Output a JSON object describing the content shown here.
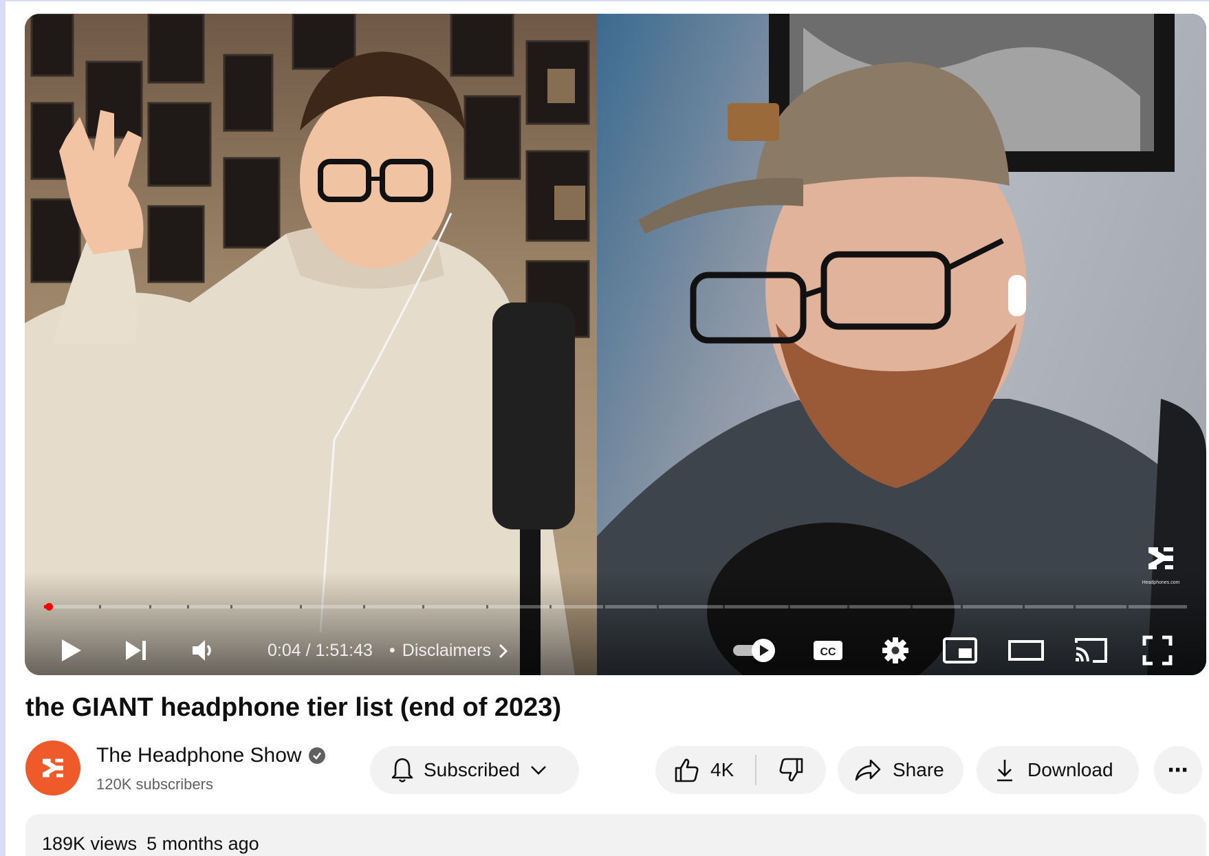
{
  "player": {
    "time_current": "0:04",
    "time_total": "1:51:43",
    "time_display": "0:04 / 1:51:43",
    "chapter_separator": "•",
    "chapter_label": "Disclaimers",
    "progress_fraction": 0.0006,
    "autoplay": "on",
    "controls": [
      "play-icon",
      "next-icon",
      "volume-icon",
      "autoplay-toggle",
      "cc-icon",
      "settings-icon",
      "miniplayer-icon",
      "theater-icon",
      "cast-icon",
      "fullscreen-icon"
    ],
    "watermark_text": "Headphones.com"
  },
  "video": {
    "title": "the GIANT headphone tier list (end of 2023)"
  },
  "channel": {
    "name": "The Headphone Show",
    "subscribers": "120K subscribers",
    "verified": true
  },
  "actions": {
    "subscribed_label": "Subscribed",
    "likes": "4K",
    "share_label": "Share",
    "download_label": "Download",
    "more_label": "⋯"
  },
  "description": {
    "views": "189K views",
    "published": "5 months ago"
  },
  "colors": {
    "accent_red": "#ff0000",
    "channel_avatar": "#ee5a2a",
    "pill_bg": "#f2f2f2"
  }
}
